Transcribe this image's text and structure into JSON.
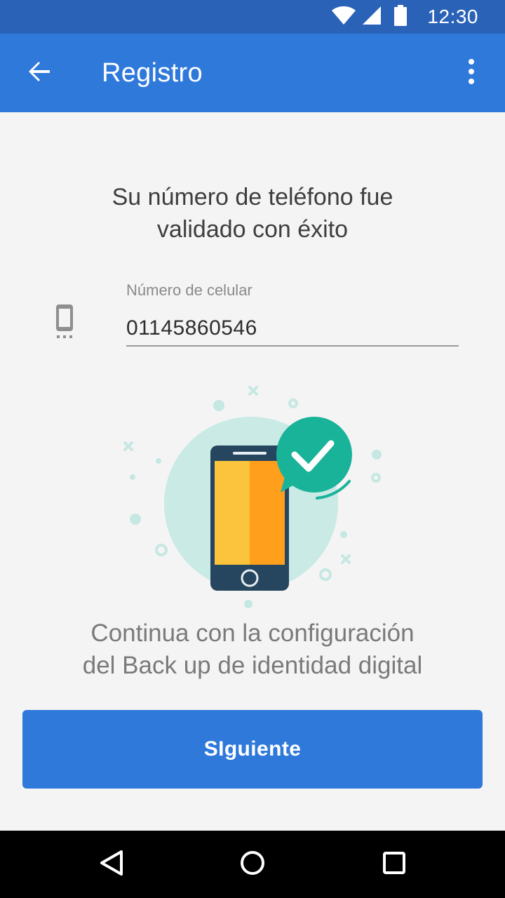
{
  "status_bar": {
    "time": "12:30",
    "icons": [
      "wifi-icon",
      "signal-icon",
      "battery-icon"
    ]
  },
  "app_bar": {
    "title": "Registro",
    "back_icon": "arrow-back-icon",
    "menu_icon": "more-vert-icon"
  },
  "main": {
    "headline_line1": "Su número de teléfono fue",
    "headline_line2": "validado con éxito",
    "phone_field": {
      "icon": "smartphone-icon",
      "label": "Número de celular",
      "value": "01145860546"
    },
    "illustration_icon": "phone-verified-illustration",
    "subtitle_line1": "Continua con la configuración",
    "subtitle_line2": "del Back up de identidad digital",
    "next_button_label": "SIguiente"
  },
  "nav_bar": {
    "icons": [
      "nav-back-icon",
      "nav-home-icon",
      "nav-recents-icon"
    ]
  },
  "colors": {
    "status_bar": "#2a62b8",
    "app_bar": "#2f79db",
    "background": "#f4f4f4",
    "button": "#2f79db",
    "accent_teal": "#19b39a",
    "phone_screen_left": "#fbc43c",
    "phone_screen_right": "#ff9f1c"
  }
}
